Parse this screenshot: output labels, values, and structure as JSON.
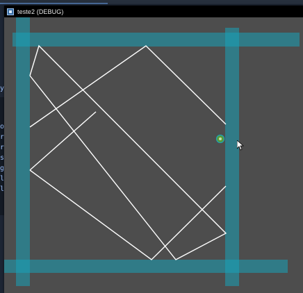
{
  "background": {
    "letters": [
      "y",
      "o",
      "r",
      "r",
      "s",
      "g",
      "l",
      "l"
    ]
  },
  "window": {
    "title": "teste2 (DEBUG)",
    "icon": "game-window-icon"
  },
  "colors": {
    "window_bg": "#4d4d4d",
    "titlebar_bg": "#000000",
    "collision_shape": "#1aa3b8",
    "line": "#ffffff",
    "token": "#5a9b3a"
  }
}
